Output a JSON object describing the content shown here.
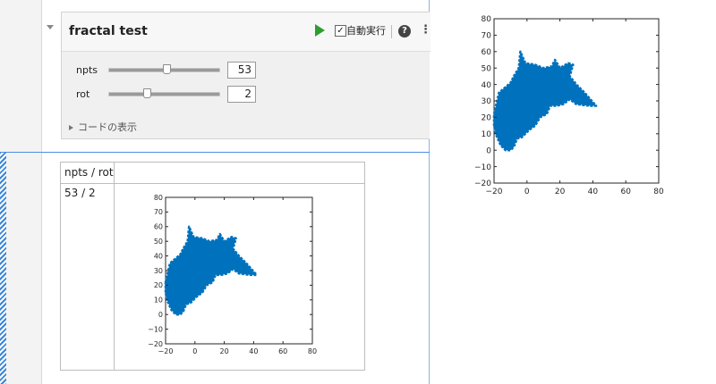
{
  "controls": {
    "title": "fractal test",
    "autorun_label": "自動実行",
    "help_glyph": "?",
    "more_glyph": "⋮",
    "params": [
      {
        "label": "npts",
        "value": "53",
        "slider_fraction": 0.53
      },
      {
        "label": "rot",
        "value": "2",
        "slider_fraction": 0.33
      }
    ],
    "code_toggle_label": "コードの表示"
  },
  "table": {
    "header": "npts / rot",
    "cell": "53 / 2"
  },
  "chart_data": [
    {
      "type": "scatter",
      "xlim": [
        -20,
        80
      ],
      "ylim": [
        -20,
        80
      ],
      "xticks": [
        -20,
        0,
        20,
        40,
        60,
        80
      ],
      "yticks": [
        -20,
        -10,
        0,
        10,
        20,
        30,
        40,
        50,
        60,
        70,
        80
      ],
      "series_color": "#0072bd",
      "shape_outline": [
        [
          -20,
          22
        ],
        [
          -17,
          35
        ],
        [
          -10,
          41
        ],
        [
          -8,
          45
        ],
        [
          -5,
          50
        ],
        [
          -4,
          60
        ],
        [
          -1,
          53
        ],
        [
          5,
          52
        ],
        [
          10,
          50
        ],
        [
          15,
          51
        ],
        [
          17,
          55
        ],
        [
          20,
          50
        ],
        [
          25,
          53
        ],
        [
          28,
          52
        ],
        [
          26,
          45
        ],
        [
          30,
          40
        ],
        [
          35,
          35
        ],
        [
          42,
          27
        ],
        [
          38,
          27
        ],
        [
          30,
          28
        ],
        [
          26,
          31
        ],
        [
          22,
          28
        ],
        [
          18,
          27
        ],
        [
          14,
          27
        ],
        [
          12,
          22
        ],
        [
          8,
          20
        ],
        [
          5,
          15
        ],
        [
          1,
          12
        ],
        [
          -3,
          8
        ],
        [
          -6,
          7
        ],
        [
          -8,
          2
        ],
        [
          -10,
          0
        ],
        [
          -13,
          0
        ],
        [
          -16,
          3
        ],
        [
          -19,
          10
        ],
        [
          -20,
          15
        ]
      ]
    },
    {
      "type": "scatter",
      "xlim": [
        -20,
        80
      ],
      "ylim": [
        -20,
        80
      ],
      "xticks": [
        -20,
        0,
        20,
        40,
        60,
        80
      ],
      "yticks": [
        -20,
        -10,
        0,
        10,
        20,
        30,
        40,
        50,
        60,
        70,
        80
      ],
      "series_color": "#0072bd",
      "shape_outline": [
        [
          -20,
          22
        ],
        [
          -17,
          35
        ],
        [
          -10,
          41
        ],
        [
          -8,
          45
        ],
        [
          -5,
          50
        ],
        [
          -4,
          60
        ],
        [
          -1,
          53
        ],
        [
          5,
          52
        ],
        [
          10,
          50
        ],
        [
          15,
          51
        ],
        [
          17,
          55
        ],
        [
          20,
          50
        ],
        [
          25,
          53
        ],
        [
          28,
          52
        ],
        [
          26,
          45
        ],
        [
          30,
          40
        ],
        [
          35,
          35
        ],
        [
          42,
          27
        ],
        [
          38,
          27
        ],
        [
          30,
          28
        ],
        [
          26,
          31
        ],
        [
          22,
          28
        ],
        [
          18,
          27
        ],
        [
          14,
          27
        ],
        [
          12,
          22
        ],
        [
          8,
          20
        ],
        [
          5,
          15
        ],
        [
          1,
          12
        ],
        [
          -3,
          8
        ],
        [
          -6,
          7
        ],
        [
          -8,
          2
        ],
        [
          -10,
          0
        ],
        [
          -13,
          0
        ],
        [
          -16,
          3
        ],
        [
          -19,
          10
        ],
        [
          -20,
          15
        ]
      ]
    }
  ]
}
